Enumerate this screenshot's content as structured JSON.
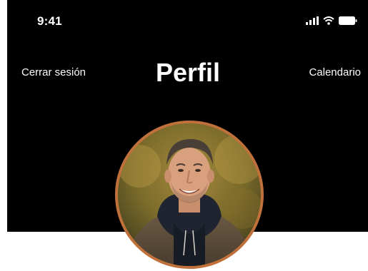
{
  "status_bar": {
    "time": "9:41",
    "icons": [
      "cellular-signal-icon",
      "wifi-icon",
      "battery-icon"
    ]
  },
  "nav": {
    "left_label": "Cerrar sesión",
    "title": "Perfil",
    "right_label": "Calendario"
  },
  "profile": {
    "avatar_border_color": "#c0703a"
  },
  "colors": {
    "header_background": "#000000",
    "page_background": "#ffffff",
    "accent": "#c0703a"
  }
}
